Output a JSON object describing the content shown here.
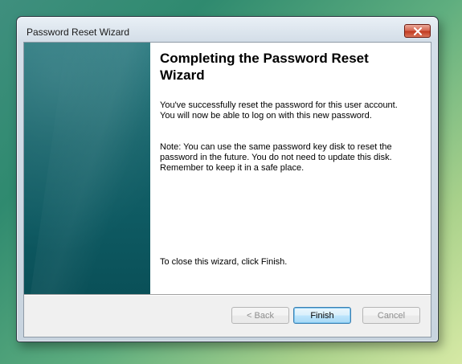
{
  "window": {
    "title": "Password Reset Wizard",
    "close_icon": "close-icon"
  },
  "wizard": {
    "heading": "Completing the Password Reset Wizard",
    "paragraph_success": "You've successfully reset the password for this user account. You will now be able to log on with this new password.",
    "paragraph_note": "Note: You can use the same password key disk to reset the password in the future. You do not need to update this disk. Remember to keep it in a safe place.",
    "paragraph_close": "To close this wizard, click Finish."
  },
  "buttons": {
    "back": {
      "label": "< Back",
      "enabled": false
    },
    "finish": {
      "label": "Finish",
      "enabled": true
    },
    "cancel": {
      "label": "Cancel",
      "enabled": false
    }
  },
  "colors": {
    "banner": "#0e5a62",
    "close_button": "#c23b21",
    "default_button_border": "#3c7fb1"
  }
}
